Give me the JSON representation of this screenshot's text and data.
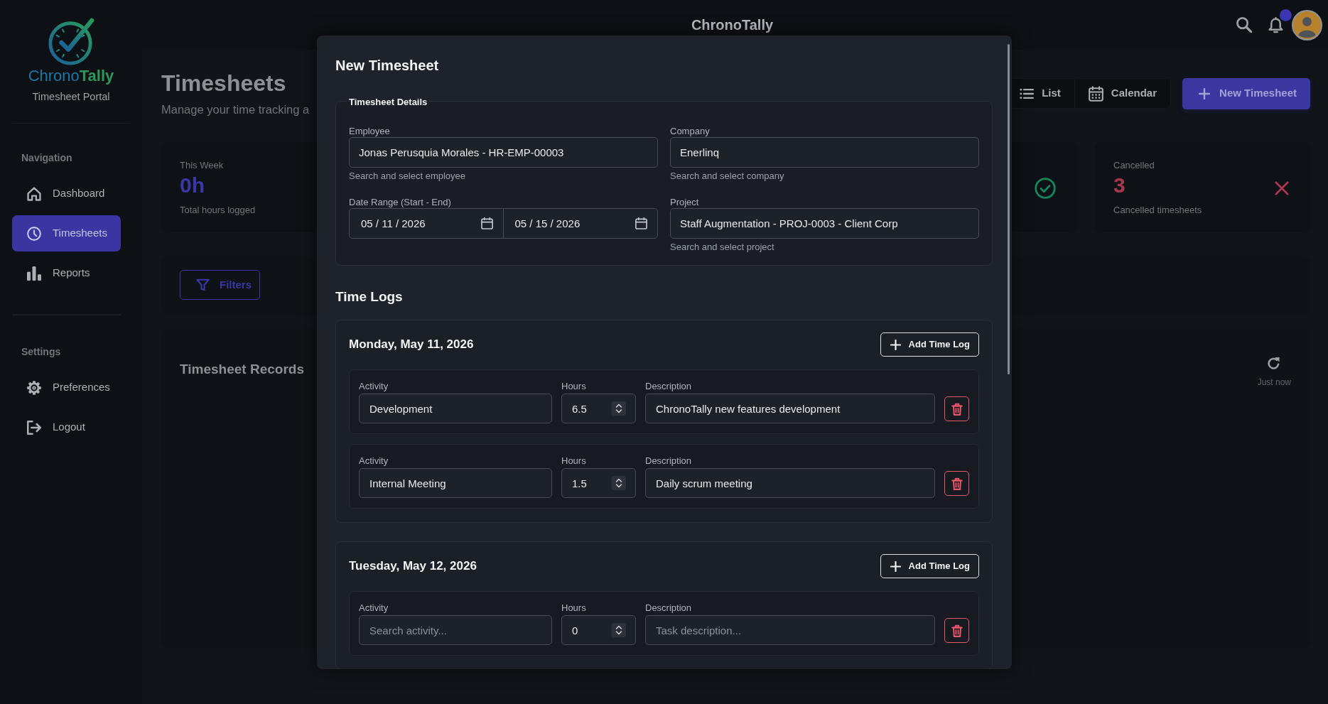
{
  "brand": {
    "name_parts": [
      "Chrono",
      "Tally"
    ],
    "subtitle": "Timesheet Portal"
  },
  "sidebar": {
    "sections": [
      {
        "title": "Navigation",
        "items": [
          {
            "label": "Dashboard",
            "selected": false
          },
          {
            "label": "Timesheets",
            "selected": true
          },
          {
            "label": "Reports",
            "selected": false
          }
        ]
      },
      {
        "title": "Settings",
        "items": [
          {
            "label": "Preferences",
            "selected": false
          },
          {
            "label": "Logout",
            "selected": false
          }
        ]
      }
    ]
  },
  "topbar": {
    "title": "ChronoTally",
    "notifications_unread": true
  },
  "page": {
    "title": "Timesheets",
    "subtitle": "Manage your time tracking a",
    "view_buttons": [
      {
        "label": "List"
      },
      {
        "label": "Calendar"
      }
    ],
    "new_button": "New Timesheet"
  },
  "stats": [
    {
      "kind": "hours",
      "label": "This Week",
      "value": "0h",
      "caption": "Total hours logged",
      "color": "#3b37a6"
    },
    {
      "kind": "check",
      "color": "#15875a"
    },
    {
      "kind": "cross",
      "label": "Cancelled",
      "value": "3",
      "caption": "Cancelled timesheets",
      "color": "#a9384e"
    }
  ],
  "filters": {
    "button": "Filters"
  },
  "records": {
    "title": "Timesheet Records",
    "updated": "Just now"
  },
  "modal": {
    "title": "New Timesheet",
    "details": {
      "legend": "Timesheet Details",
      "employee": {
        "label": "Employee",
        "value": "Jonas Perusquia Morales - HR-EMP-00003",
        "help": "Search and select employee"
      },
      "company": {
        "label": "Company",
        "value": "Enerlinq",
        "help": "Search and select company"
      },
      "date_range": {
        "label": "Date Range (Start - End)",
        "start": "05 / 11 / 2026",
        "end": "05 / 15 / 2026"
      },
      "project": {
        "label": "Project",
        "value": "Staff Augmentation - PROJ-0003 - Client Corp",
        "help": "Search and select project"
      }
    },
    "time_logs": {
      "title": "Time Logs",
      "days": [
        {
          "date": "Monday, May 11, 2026",
          "add_button": "Add Time Log",
          "entries": [
            {
              "activity": {
                "label": "Activity",
                "value": "Development"
              },
              "hours": {
                "label": "Hours",
                "value": "6.5"
              },
              "description": {
                "label": "Description",
                "value": "ChronoTally new features development"
              }
            },
            {
              "activity": {
                "label": "Activity",
                "value": "Internal Meeting"
              },
              "hours": {
                "label": "Hours",
                "value": "1.5"
              },
              "description": {
                "label": "Description",
                "value": "Daily scrum meeting"
              }
            }
          ]
        },
        {
          "date": "Tuesday, May 12, 2026",
          "add_button": "Add Time Log",
          "entries": [
            {
              "activity": {
                "label": "Activity",
                "placeholder": "Search activity..."
              },
              "hours": {
                "label": "Hours",
                "value": "0"
              },
              "description": {
                "label": "Description",
                "placeholder": "Task description..."
              }
            }
          ]
        }
      ]
    }
  }
}
